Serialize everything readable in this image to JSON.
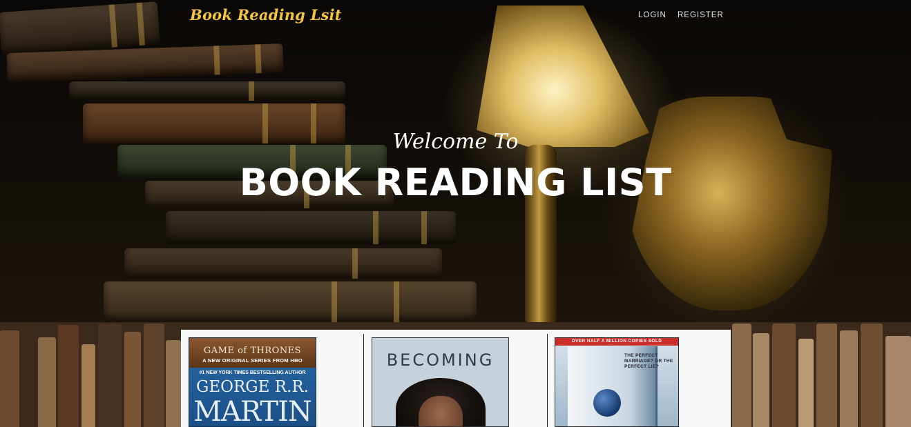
{
  "navbar": {
    "brand": "Book Reading Lsit",
    "links": [
      "LOGIN",
      "REGISTER"
    ]
  },
  "hero": {
    "welcome": "Welcome To",
    "headline": "BOOK READING LIST"
  },
  "books": [
    {
      "series_title": "GAME of THRONES",
      "series_sub": "A NEW ORIGINAL SERIES FROM HBO",
      "tagline": "#1 NEW YORK TIMES BESTSELLING AUTHOR",
      "author_first": "GEORGE R.R.",
      "author_last": "MARTIN"
    },
    {
      "title": "BECOMING"
    },
    {
      "banner": "OVER HALF A MILLION COPIES SOLD",
      "blurb": "THE PERFECT MARRIAGE? OR THE PERFECT LIE?"
    }
  ],
  "icons": [
    "book-cover-image",
    "hero-background-image"
  ],
  "colors": {
    "brand": "#f4c542",
    "panel": "#f7f8f8",
    "text_light": "#ffffff"
  }
}
